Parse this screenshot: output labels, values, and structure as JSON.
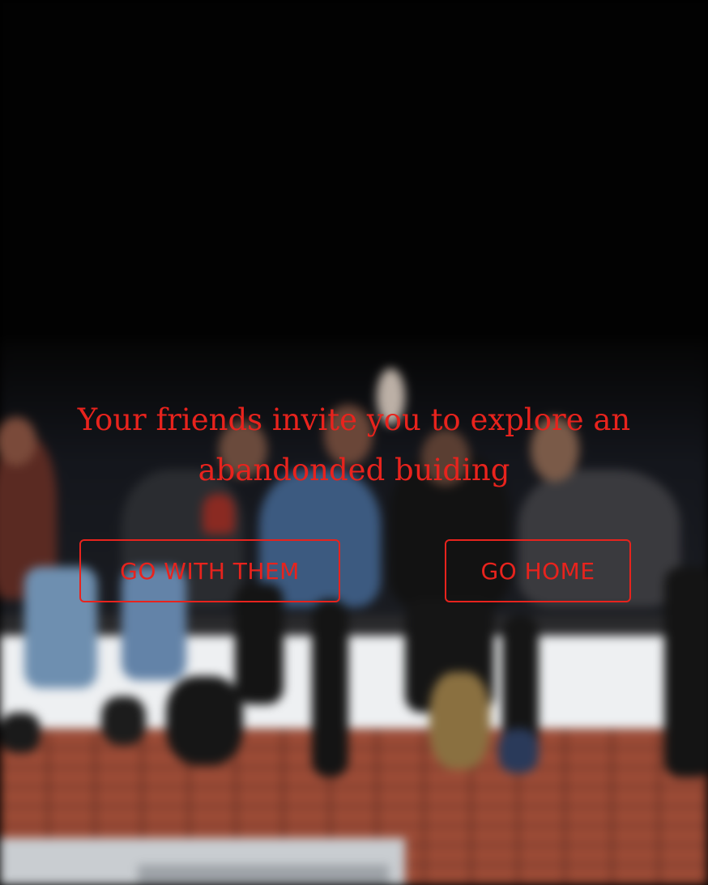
{
  "scene": {
    "prompt": "Your friends invite you to explore an abandonded buiding"
  },
  "choices": [
    {
      "label": "GO WITH THEM"
    },
    {
      "label": "GO HOME"
    }
  ],
  "colors": {
    "accent": "#e8231d",
    "background": "#000000"
  }
}
